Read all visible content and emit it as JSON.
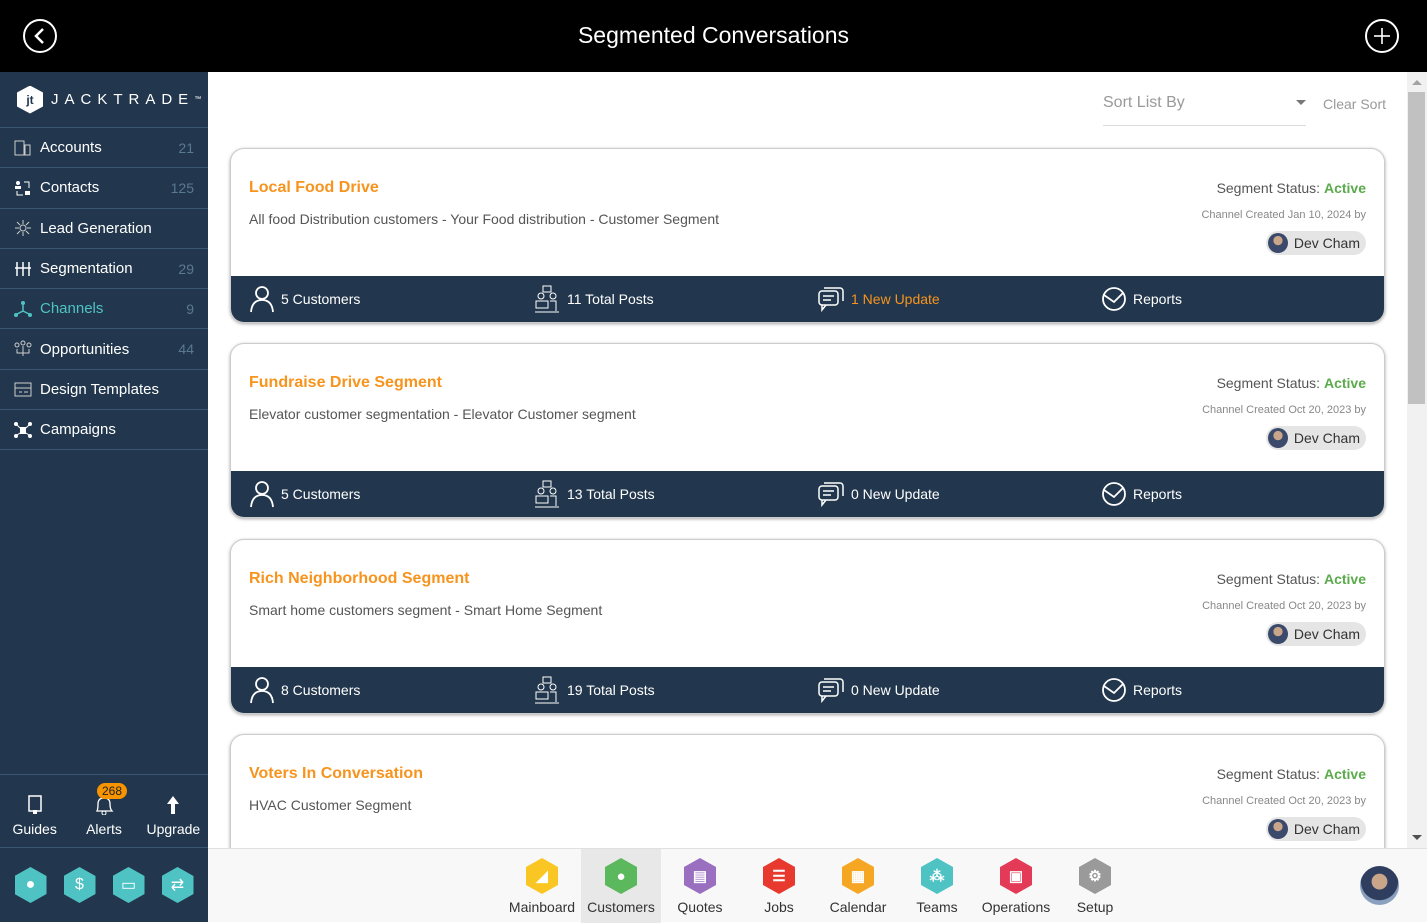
{
  "header": {
    "title": "Segmented Conversations",
    "back_icon": "back-circle-icon",
    "add_icon": "plus-circle-icon"
  },
  "sidebar": {
    "brand": "JACKTRADE",
    "items": [
      {
        "label": "Accounts",
        "count": "21",
        "icon": "building-icon"
      },
      {
        "label": "Contacts",
        "count": "125",
        "icon": "contacts-icon"
      },
      {
        "label": "Lead Generation",
        "count": "",
        "icon": "lead-generation-icon"
      },
      {
        "label": "Segmentation",
        "count": "29",
        "icon": "segmentation-icon"
      },
      {
        "label": "Channels",
        "count": "9",
        "icon": "channels-icon",
        "active": true
      },
      {
        "label": "Opportunities",
        "count": "44",
        "icon": "opportunities-icon"
      },
      {
        "label": "Design Templates",
        "count": "",
        "icon": "design-templates-icon"
      },
      {
        "label": "Campaigns",
        "count": "",
        "icon": "campaigns-icon"
      }
    ],
    "bottom": [
      {
        "label": "Guides",
        "icon": "book-icon"
      },
      {
        "label": "Alerts",
        "icon": "bell-icon",
        "badge": "268"
      },
      {
        "label": "Upgrade",
        "icon": "arrow-up-icon"
      }
    ],
    "quick": [
      "user-hex-icon",
      "dollar-hex-icon",
      "money-hex-icon",
      "flow-hex-icon"
    ]
  },
  "toolbar": {
    "sort_placeholder": "Sort List By",
    "clear_sort": "Clear Sort"
  },
  "cards": [
    {
      "title": "Local Food Drive",
      "desc": "All food Distribution customers - Your Food distribution - Customer Segment",
      "status_label": "Segment Status:",
      "status": "Active",
      "created": "Channel Created Jan 10, 2024 by",
      "owner": "Dev Cham",
      "customers": "5 Customers",
      "posts": "11 Total Posts",
      "updates": "1 New Update",
      "updates_highlight": true,
      "reports": "Reports"
    },
    {
      "title": "Fundraise Drive Segment",
      "desc": "Elevator customer segmentation - Elevator Customer segment",
      "status_label": "Segment Status:",
      "status": "Active",
      "created": "Channel Created Oct 20, 2023 by",
      "owner": "Dev Cham",
      "customers": "5 Customers",
      "posts": "13 Total Posts",
      "updates": "0 New Update",
      "updates_highlight": false,
      "reports": "Reports"
    },
    {
      "title": "Rich Neighborhood Segment",
      "desc": "Smart home customers segment - Smart Home Segment",
      "status_label": "Segment Status:",
      "status": "Active",
      "created": "Channel Created Oct 20, 2023 by",
      "owner": "Dev Cham",
      "customers": "8 Customers",
      "posts": "19 Total Posts",
      "updates": "0 New Update",
      "updates_highlight": false,
      "reports": "Reports"
    },
    {
      "title": "Voters In Conversation",
      "desc": "HVAC Customer Segment",
      "status_label": "Segment Status:",
      "status": "Active",
      "created": "Channel Created Oct 20, 2023 by",
      "owner": "Dev Cham",
      "customers": "",
      "posts": "",
      "updates": "",
      "updates_highlight": false,
      "reports": ""
    }
  ],
  "apps": [
    {
      "label": "Mainboard",
      "color": "#f9c623"
    },
    {
      "label": "Customers",
      "color": "#5cb85c",
      "active": true
    },
    {
      "label": "Quotes",
      "color": "#9b6fc0"
    },
    {
      "label": "Jobs",
      "color": "#e8392e"
    },
    {
      "label": "Calendar",
      "color": "#f5a623"
    },
    {
      "label": "Teams",
      "color": "#4fc3c4"
    },
    {
      "label": "Operations",
      "color": "#e33a57"
    },
    {
      "label": "Setup",
      "color": "#9a9a9a"
    }
  ],
  "colors": {
    "accent": "#f7941d",
    "active": "#5bab4c",
    "sidebar": "#22374d",
    "teal": "#4fc3c4"
  }
}
